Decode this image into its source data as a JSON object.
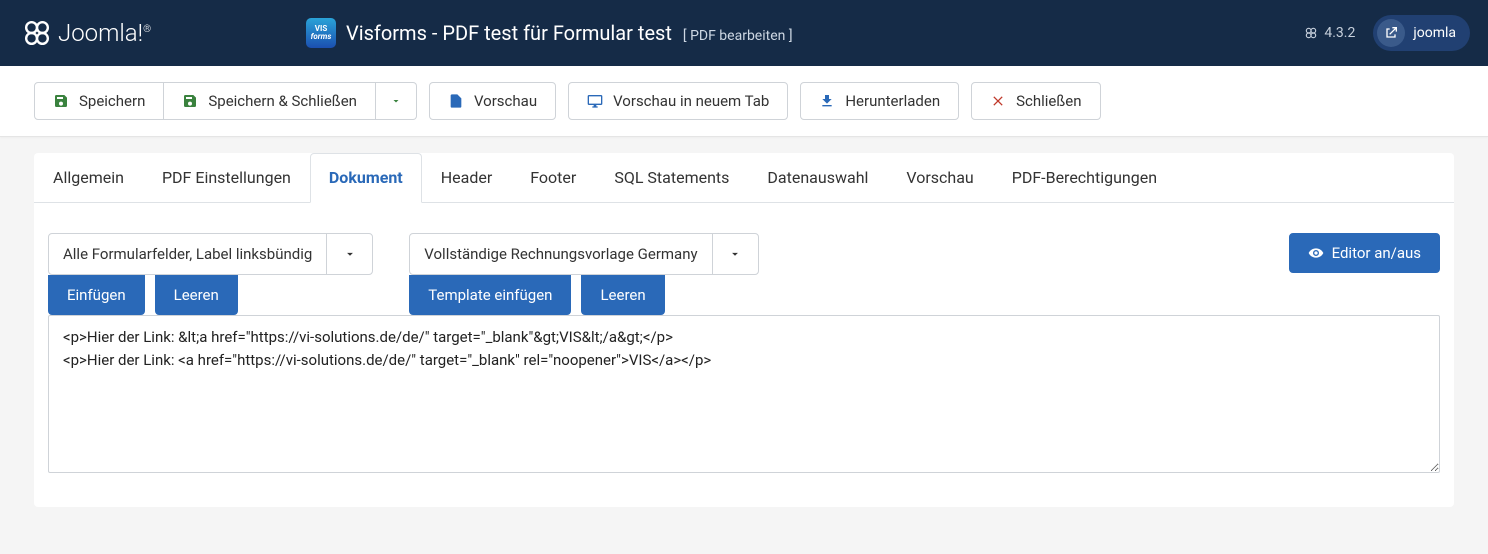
{
  "header": {
    "brand": "Joomla!",
    "app_icon_top": "VIS",
    "app_icon_bottom": "forms",
    "title": "Visforms - PDF test für Formular test",
    "subtitle": "[ PDF bearbeiten ]",
    "version": "4.3.2",
    "user": "joomla"
  },
  "toolbar": {
    "save": "Speichern",
    "save_close": "Speichern & Schließen",
    "preview": "Vorschau",
    "preview_new_tab": "Vorschau in neuem Tab",
    "download": "Herunterladen",
    "close": "Schließen"
  },
  "tabs": [
    {
      "label": "Allgemein",
      "active": false
    },
    {
      "label": "PDF Einstellungen",
      "active": false
    },
    {
      "label": "Dokument",
      "active": true
    },
    {
      "label": "Header",
      "active": false
    },
    {
      "label": "Footer",
      "active": false
    },
    {
      "label": "SQL Statements",
      "active": false
    },
    {
      "label": "Datenauswahl",
      "active": false
    },
    {
      "label": "Vorschau",
      "active": false
    },
    {
      "label": "PDF-Berechtigungen",
      "active": false
    }
  ],
  "document_panel": {
    "field_select": "Alle Formularfelder, Label linksbündig",
    "template_select": "Vollständige Rechnungsvorlage Germany",
    "insert": "Einfügen",
    "clear": "Leeren",
    "template_insert": "Template einfügen",
    "clear2": "Leeren",
    "editor_toggle": "Editor an/aus",
    "code": "<p>Hier der Link: &lt;a href=\"https://vi-solutions.de/de/\" target=\"_blank\"&gt;VIS&lt;/a&gt;</p>\n<p>Hier der Link: <a href=\"https://vi-solutions.de/de/\" target=\"_blank\" rel=\"noopener\">VIS</a></p>"
  }
}
